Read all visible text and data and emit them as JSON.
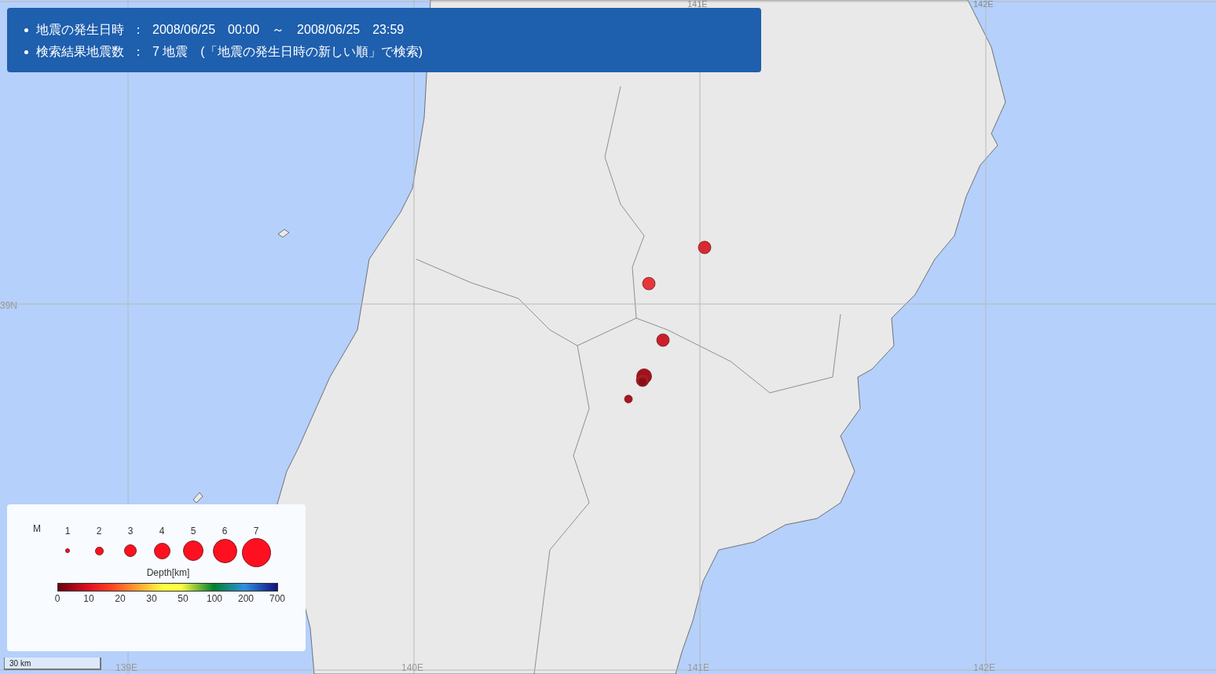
{
  "info": {
    "lines": [
      {
        "label": "地震の発生日時",
        "sep": "：",
        "value": "2008/06/25　00:00　～　2008/06/25　23:59"
      },
      {
        "label": "検索結果地震数",
        "sep": "：",
        "value": "7 地震　(「地震の発生日時の新しい順」で検索)"
      }
    ]
  },
  "grid_labels": {
    "top": [
      "141E",
      "142E"
    ],
    "bottom": [
      "139E",
      "140E",
      "141E",
      "142E"
    ],
    "left": [
      "39N"
    ]
  },
  "earthquakes": [
    {
      "color": "#d92a32",
      "kind": "medium"
    },
    {
      "color": "#e8353a",
      "kind": "medium"
    },
    {
      "color": "#c9202b",
      "kind": "medium"
    },
    {
      "color": "#a3121c",
      "kind": "large"
    },
    {
      "color": "#b01822",
      "kind": "medium"
    },
    {
      "color": "#8c0c14",
      "kind": "small"
    },
    {
      "color": "#a81520",
      "kind": "small"
    }
  ],
  "legend": {
    "magnitude_label": "M",
    "magnitudes": [
      "1",
      "2",
      "3",
      "4",
      "5",
      "6",
      "7"
    ],
    "depth_title": "Depth[km]",
    "depth_ticks": [
      "0",
      "10",
      "20",
      "30",
      "50",
      "100",
      "200",
      "700"
    ]
  },
  "scale_bar": "30 km"
}
